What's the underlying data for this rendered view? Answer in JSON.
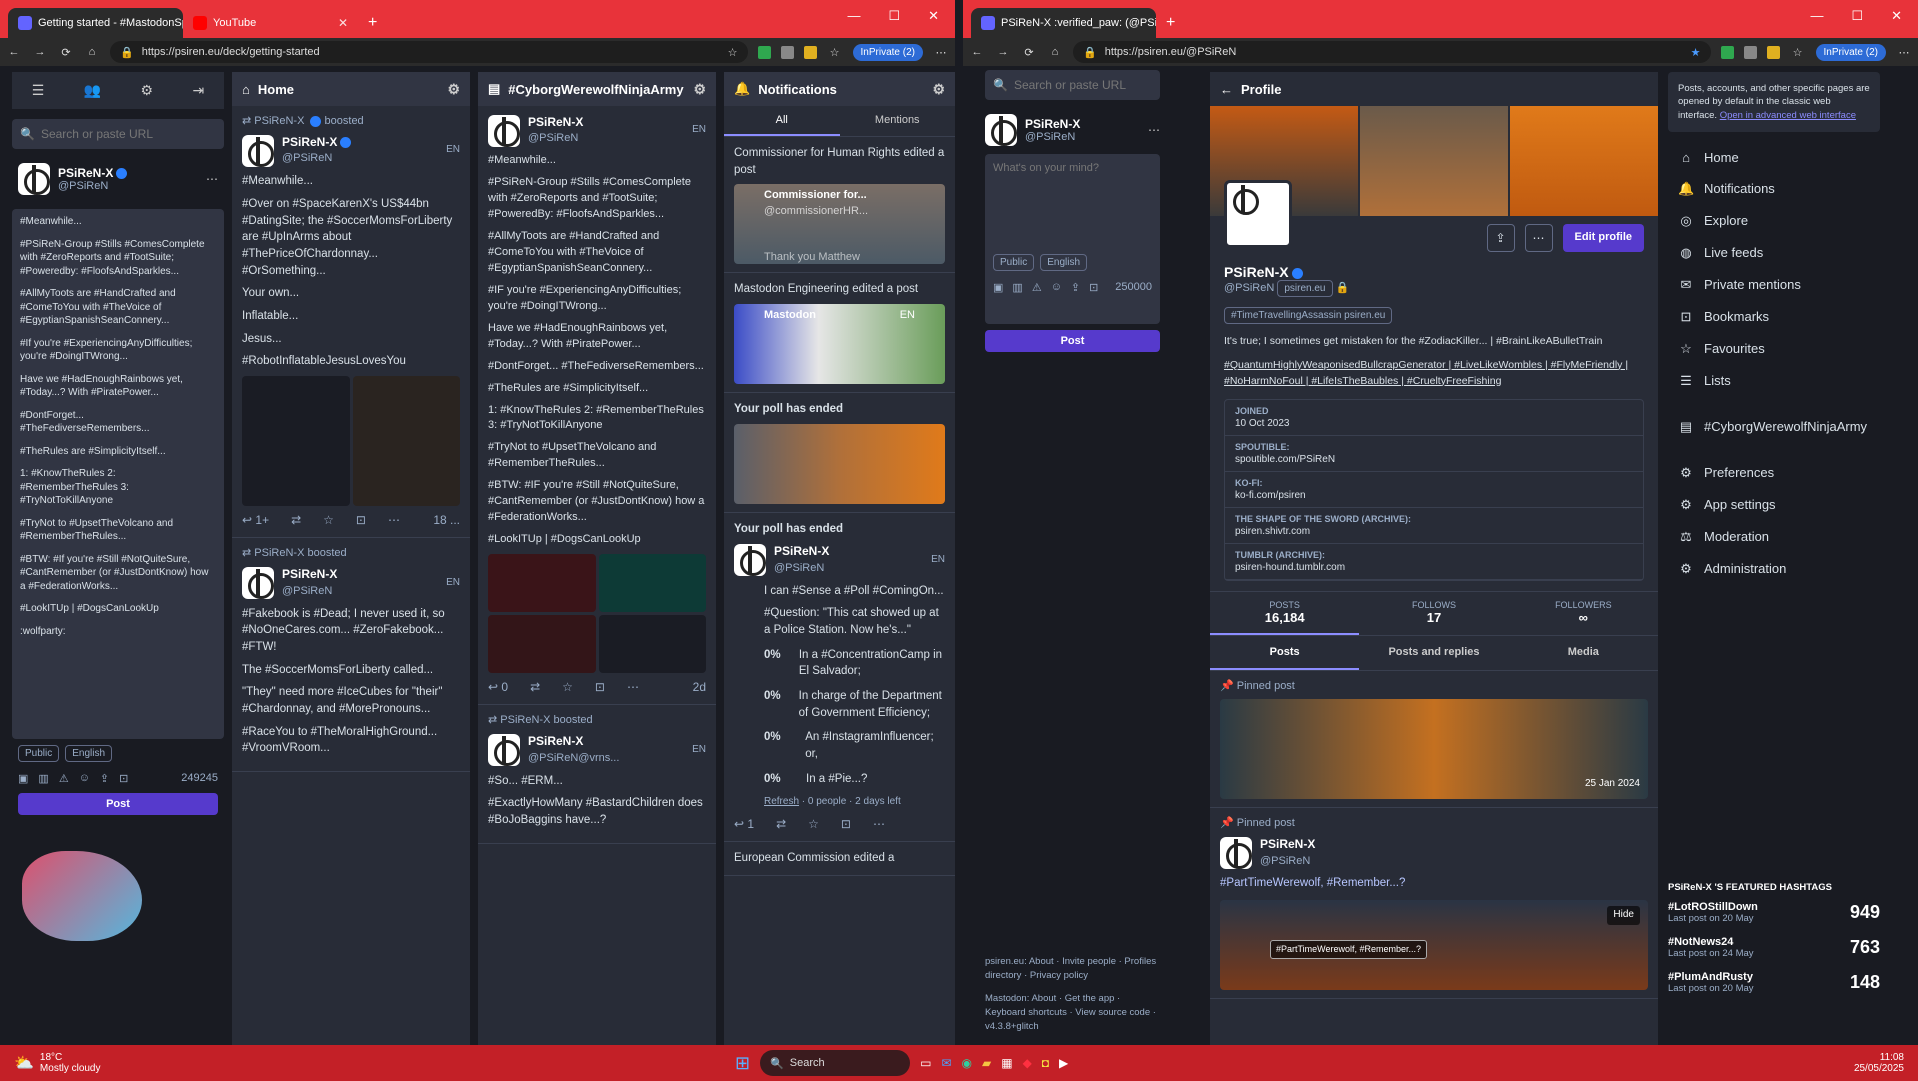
{
  "left_browser": {
    "tabs": [
      {
        "label": "Getting started - #MastodonSpy..."
      },
      {
        "label": "YouTube"
      }
    ],
    "url": "https://psiren.eu/deck/getting-started",
    "inprivate": "InPrivate (2)"
  },
  "right_browser": {
    "tabs": [
      {
        "label": "PSiReN-X :verified_paw: (@PSiReN..."
      }
    ],
    "url": "https://psiren.eu/@PSiReN",
    "inprivate": "InPrivate (2)"
  },
  "compose": {
    "search_placeholder": "Search or paste URL",
    "user_name": "PSiReN-X",
    "user_handle": "@PSiReN",
    "draft_lines": [
      "#Meanwhile...",
      "#PSiReN-Group #Stills #ComesComplete with #ZeroReports and #TootSuite; #Poweredby: #FloofsAndSparkles...",
      "#AllMyToots are #HandCrafted and #ComeToYou with #TheVoice of #EgyptianSpanishSeanConnery...",
      "#If you're #ExperiencingAnyDifficulties; you're #DoingITWrong...",
      "Have we #HadEnoughRainbows yet, #Today...? With #PiratePower...",
      "#DontForget... #TheFediverseRemembers...",
      "#TheRules are #SimplicityItself...",
      "1: #KnowTheRules 2: #RememberTheRules 3: #TryNotToKillAnyone",
      "#TryNot to #UpsetTheVolcano and #RememberTheRules...",
      "#BTW: #If you're #Still #NotQuiteSure, #CantRemember (or #JustDontKnow) how a #FederationWorks...",
      "#LookITUp | #DogsCanLookUp",
      ":wolfparty:"
    ],
    "visibility": "Public",
    "language": "English",
    "char_count": "249245",
    "post_label": "Post"
  },
  "home": {
    "title": "Home",
    "posts": [
      {
        "boosted_by": "PSiReN-X",
        "boost_label": "boosted",
        "name": "PSiReN-X",
        "handle": "@PSiReN",
        "lang": "EN",
        "lines": [
          "#Meanwhile...",
          "#Over on #SpaceKarenX's US$44bn #DatingSite; the #SoccerMomsForLiberty are #UpInArms about #ThePriceOfChardonnay... #OrSomething...",
          "Your own...",
          "Inflatable...",
          "Jesus...",
          "#RobotInflatableJesusLovesYou"
        ],
        "reply_count": "1+",
        "time": "18 ..."
      },
      {
        "boosted_by": "PSiReN-X",
        "boost_label": "boosted",
        "name": "PSiReN-X",
        "handle": "@PSiReN",
        "lang": "EN",
        "lines": [
          "#Fakebook is #Dead; I never used it, so #NoOneCares.com... #ZeroFakebook... #FTW!",
          "The #SoccerMomsForLiberty called...",
          "\"They\" need more #IceCubes for \"their\" #Chardonnay, and #MorePronouns...",
          "#RaceYou to #TheMoralHighGround... #VroomVRoom..."
        ]
      }
    ]
  },
  "hashtag_col": {
    "title": "#CyborgWerewolfNinjaArmy",
    "posts": [
      {
        "name": "PSiReN-X",
        "handle": "@PSiReN",
        "lang": "EN",
        "lines": [
          "#Meanwhile...",
          "#PSiReN-Group #Stills #ComesComplete with #ZeroReports and #TootSuite; #PoweredBy: #FloofsAndSparkles...",
          "#AllMyToots are #HandCrafted and #ComeToYou with #TheVoice of #EgyptianSpanishSeanConnery...",
          "#IF you're #ExperiencingAnyDifficulties; you're #DoingITWrong...",
          "Have we #HadEnoughRainbows yet, #Today...? With #PiratePower...",
          "#DontForget... #TheFediverseRemembers...",
          "#TheRules are #SimplicityItself...",
          "1: #KnowTheRules 2: #RememberTheRules 3: #TryNotToKillAnyone",
          "#TryNot to #UpsetTheVolcano and #RememberTheRules...",
          "#BTW: #IF you're #Still #NotQuiteSure, #CantRemember (or #JustDontKnow) how a #FederationWorks...",
          "#LookITUp | #DogsCanLookUp"
        ],
        "reply_count": "0",
        "time": "2d"
      },
      {
        "boosted_by": "PSiReN-X",
        "boost_label": "boosted",
        "name": "PSiReN-X",
        "handle": "@PSiReN@vrns...",
        "lang": "EN",
        "lines": [
          "#So... #ERM...",
          "#ExactlyHowMany #BastardChildren does #BoJoBaggins have...?"
        ]
      }
    ]
  },
  "notifications": {
    "title": "Notifications",
    "tabs": [
      "All",
      "Mentions"
    ],
    "items": [
      {
        "text": "Commissioner for Human Rights edited a post",
        "card_title": "Commissioner for...",
        "card_handle": "@commissionerHR...",
        "card_caption": "Thank you Matthew"
      },
      {
        "text": "Mastodon Engineering edited a post",
        "card_title": "Mastodon",
        "card_lang": "EN"
      },
      {
        "text": "Your poll has ended"
      },
      {
        "text": "Your poll has ended"
      }
    ],
    "poll_post": {
      "name": "PSiReN-X",
      "handle": "@PSiReN",
      "lang": "EN",
      "lead": "I can #Sense a #Poll #ComingOn...",
      "question": "#Question: \"This cat showed up at a Police Station. Now he's...\"",
      "options": [
        {
          "pct": "0%",
          "label": "In a #ConcentrationCamp in El Salvador;"
        },
        {
          "pct": "0%",
          "label": "In charge of the Department of Government Efficiency;"
        },
        {
          "pct": "0%",
          "label": "An #InstagramInfluencer; or,"
        },
        {
          "pct": "0%",
          "label": "In a #Pie...?"
        }
      ],
      "refresh": "Refresh",
      "meta": "0 people · 2 days left",
      "reply_count": "1"
    },
    "last_item": "European Commission edited a"
  },
  "right_compose": {
    "search_placeholder": "Search or paste URL",
    "user_name": "PSiReN-X",
    "user_handle": "@PSiReN",
    "placeholder": "What's on your mind?",
    "visibility": "Public",
    "language": "English",
    "char_count": "250000",
    "post_label": "Post",
    "footer1": "psiren.eu: About · Invite people · Profiles directory · Privacy policy",
    "footer2": "Mastodon: About · Get the app · Keyboard shortcuts · View source code · v4.3.8+glitch"
  },
  "profile": {
    "back_label": "Profile",
    "name": "PSiReN-X",
    "handle": "@PSiReN",
    "domain_badge": "psiren.eu",
    "edit_label": "Edit profile",
    "featured_tag": "#TimeTravellingAssassin psiren.eu",
    "bio1": "It's true; I sometimes get mistaken for the #ZodiacKiller... | #BrainLikeABulletTrain",
    "bio2": "#QuantumHighlyWeaponisedBullcrapGenerator | #LiveLikeWombles | #FlyMeFriendly | #NoHarmNoFoul | #LifeIsTheBaubles | #CrueltyFreeFishing",
    "fields": [
      {
        "k": "Joined",
        "v": "10 Oct 2023"
      },
      {
        "k": "Spoutible:",
        "v": "spoutible.com/PSiReN"
      },
      {
        "k": "Ko-fi:",
        "v": "ko-fi.com/psiren"
      },
      {
        "k": "The Shape of the Sword (archive):",
        "v": "psiren.shivtr.com"
      },
      {
        "k": "Tumblr (archive):",
        "v": "psiren-hound.tumblr.com"
      }
    ],
    "stats": [
      {
        "k": "Posts",
        "v": "16,184"
      },
      {
        "k": "Follows",
        "v": "17"
      },
      {
        "k": "Followers",
        "v": "∞"
      }
    ],
    "tabs": [
      "Posts",
      "Posts and replies",
      "Media"
    ],
    "pinned_label": "Pinned post",
    "pinned_date": "25 Jan 2024",
    "pinned2_name": "PSiReN-X",
    "pinned2_handle": "@PSiReN",
    "pinned2_text": "#PartTimeWerewolf, #Remember...?",
    "pinned2_alt": "#PartTimeWerewolf, #Remember...?",
    "hide_label": "Hide"
  },
  "nav": {
    "notice": "Posts, accounts, and other specific pages are opened by default in the classic web interface.",
    "notice_link": "Open in advanced web interface",
    "items": [
      "Home",
      "Notifications",
      "Explore",
      "Live feeds",
      "Private mentions",
      "Bookmarks",
      "Favourites",
      "Lists",
      "#CyborgWerewolfNinjaArmy",
      "Preferences",
      "App settings",
      "Moderation",
      "Administration"
    ],
    "featured_title": "PSiReN-X 'S FEATURED HASHTAGS",
    "hashtags": [
      {
        "tag": "#LotROStillDown",
        "meta": "Last post on 20 May",
        "count": "949"
      },
      {
        "tag": "#NotNews24",
        "meta": "Last post on 24 May",
        "count": "763"
      },
      {
        "tag": "#PlumAndRusty",
        "meta": "Last post on 20 May",
        "count": "148"
      }
    ]
  },
  "taskbar": {
    "temp": "18°C",
    "weather": "Mostly cloudy",
    "search": "Search",
    "time": "11:08",
    "date": "25/05/2025"
  },
  "colors": {
    "accent": "#563acc",
    "tabbar": "#e8333a",
    "taskbar": "#c32027",
    "bg": "#191b22",
    "column": "#282c37"
  }
}
